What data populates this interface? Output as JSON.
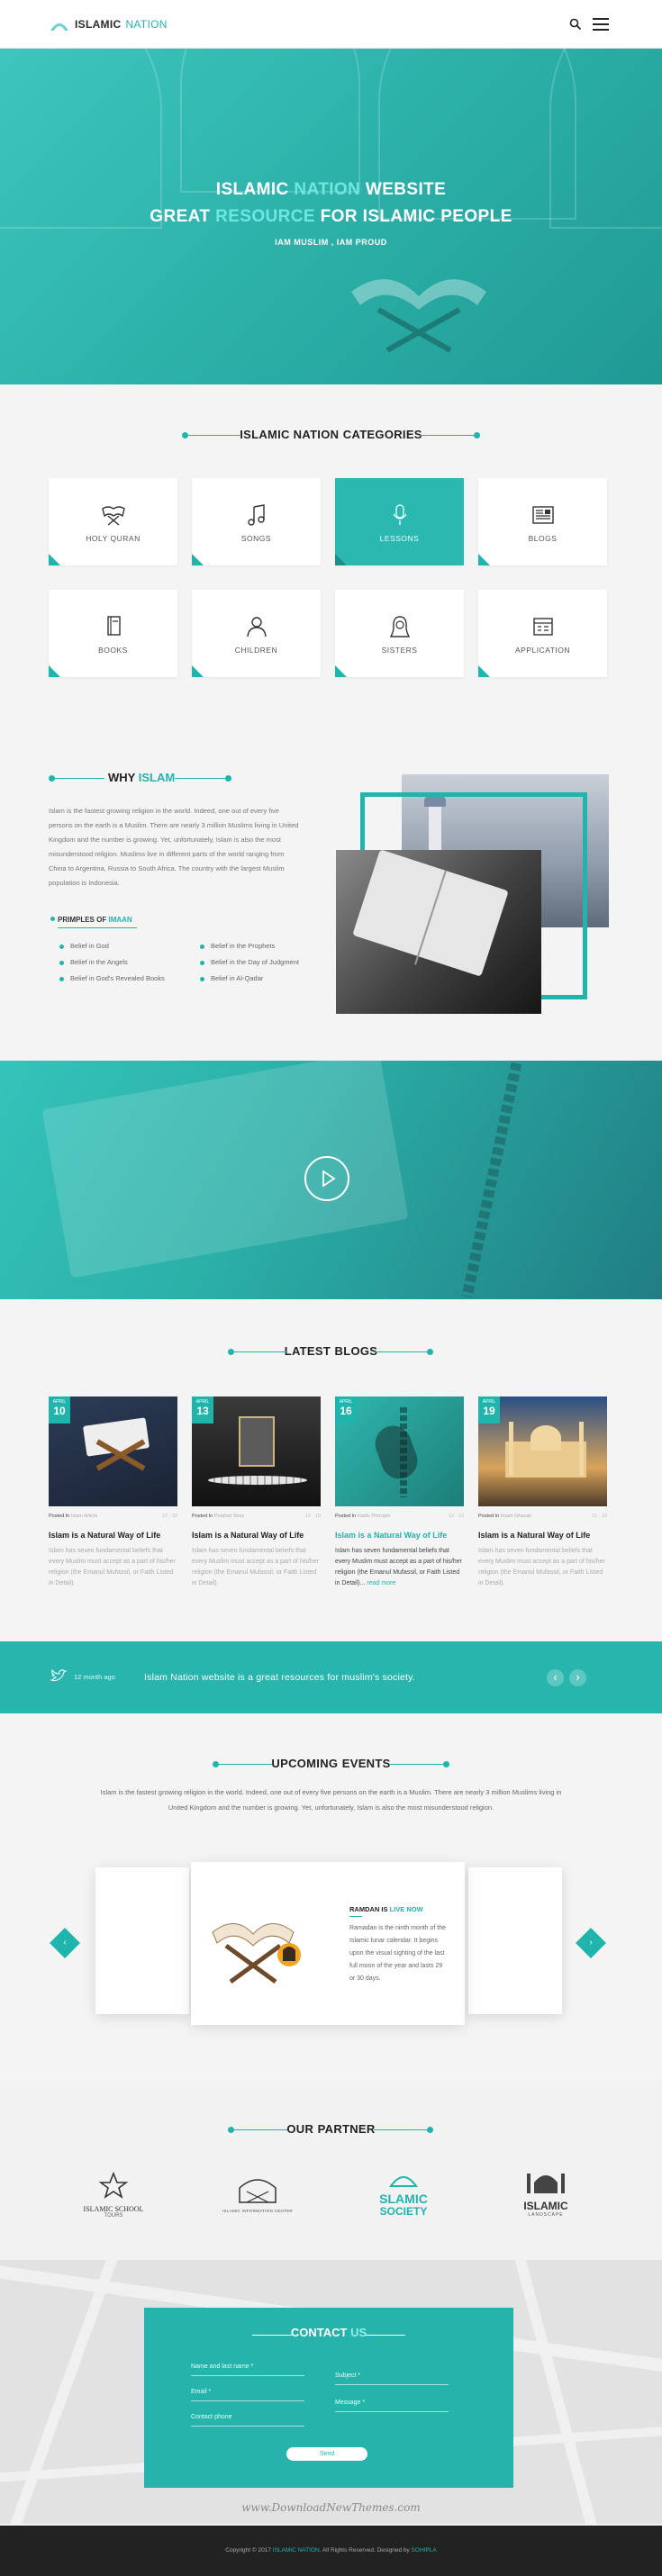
{
  "header": {
    "logo_bold": "ISLAMIC",
    "logo_light": "NATION",
    "search_icon": "search-icon",
    "menu_icon": "hamburger-icon"
  },
  "hero": {
    "line1_a": "ISLAMIC",
    "line1_hl": "NATION",
    "line1_b": "WEBSITE",
    "line2_a": "GREAT",
    "line2_hl": "RESOURCE",
    "line2_b": "FOR ISLAMIC PEOPLE",
    "subtitle": "IAM MUSLIM , IAM PROUD"
  },
  "categories": {
    "title_a": "ISLAMIC NATION",
    "title_b": "CATEGORIES",
    "items": [
      {
        "label": "HOLY QURAN",
        "icon": "quran-icon"
      },
      {
        "label": "SONGS",
        "icon": "music-note-icon"
      },
      {
        "label": "LESSONS",
        "icon": "microphone-icon"
      },
      {
        "label": "BLOGS",
        "icon": "newspaper-icon"
      },
      {
        "label": "BOOKS",
        "icon": "book-icon"
      },
      {
        "label": "CHILDREN",
        "icon": "child-icon"
      },
      {
        "label": "SISTERS",
        "icon": "hijab-icon"
      },
      {
        "label": "APPLICATION",
        "icon": "application-icon"
      }
    ]
  },
  "why": {
    "title_a": "WHY",
    "title_b": "ISLAM",
    "text": "Islam is the fastest growing religion in the world. Indeed, one out of every five persons on the earth is a Muslim. There are nearly 3 million Muslims living in United Kingdom and the number is growing. Yet, unfortunately, Islam is also the most misunderstood religion. Muslims live in different parts of the world ranging from China to Argentina, Russia to South Africa. The country with the largest Muslim population is Indonesia.",
    "principles_a": "PRIMPLES OF",
    "principles_b": "IMAAN",
    "beliefs": [
      "Belief in God",
      "Belief in the Prophets",
      "Belief in the Angels",
      "Belief in the Day of Judgment",
      "Belief in God's Revealed Books",
      "Belief in Al-Qadar"
    ]
  },
  "video": {
    "play_icon": "play-icon"
  },
  "blogs": {
    "title_a": "LATEST",
    "title_b": "BLOGS",
    "items": [
      {
        "month": "APRIL",
        "day": "10",
        "posted": "Posted In",
        "author": "Islam Article",
        "counts": "12  ·  10",
        "title": "Islam is a Natural Way of Life",
        "excerpt": "Islam has seven fundamental beliefs that every Muslim must accept as a part of his/her religion (the Emanul Mufassil, or Faith Listed in Detail)."
      },
      {
        "month": "APRIL",
        "day": "13",
        "posted": "Posted In",
        "author": "Prophet Story",
        "counts": "12  ·  10",
        "title": "Islam is a Natural Way of Life",
        "excerpt": "Islam has seven fundamental beliefs that every Muslim must accept as a part of his/her religion (the Emanul Mufassil, or Faith Listed in Detail)."
      },
      {
        "month": "APRIL",
        "day": "16",
        "posted": "Posted In",
        "author": "Hadis Principle",
        "counts": "12  ·  10",
        "title": "Islam is a Natural Way of Life",
        "excerpt": "Islam has seven fundamental beliefs that every Muslim must accept as a part of his/her religion (the Emanul Mufassil, or Faith Listed in Detail)...",
        "read_more": "read more"
      },
      {
        "month": "APRIL",
        "day": "19",
        "posted": "Posted In",
        "author": "Imam Ghazali",
        "counts": "12  ·  10",
        "title": "Islam is a Natural Way of Life",
        "excerpt": "Islam has seven fundamental beliefs that every Muslim must accept as a part of his/her religion (the Emanul Mufassil, or Faith Listed in Detail)."
      }
    ]
  },
  "tweet": {
    "time": "12 month ago",
    "text": "Islam Nation website is a great resources for muslim's society.",
    "prev": "‹",
    "next": "›"
  },
  "events": {
    "title_a": "UPCOMING",
    "title_b": "EVENTS",
    "description": "Islam is the fastest growing religion in the world. Indeed, one out of every five persons on the earth is a Muslim. There are nearly 3 million Muslims living in United Kingdom and the number is growing. Yet, unfortunately, Islam is also the most misunderstood religion.",
    "card_title_a": "RAMDAN IS",
    "card_title_b": "LIVE NOW",
    "card_text": "Ramadan is the ninth month of the Islamic lunar calendar. It begins upon the visual sighting of the last full moon of the year and lasts 29 or 30 days.",
    "prev": "‹",
    "next": "›"
  },
  "partner": {
    "title_a": "OUR",
    "title_b": "PARTNER",
    "logos": [
      {
        "line1": "ISLAMIC SCHOOL",
        "line2": "TOURS"
      },
      {
        "line1": "ISLAMIC INFORMATION CENTER",
        "line2": ""
      },
      {
        "line1": "SLAMIC",
        "line2": "SOCIETY"
      },
      {
        "line1": "ISLAMIC",
        "line2": "LANDSCAPE"
      }
    ]
  },
  "contact": {
    "title_a": "CONTACT",
    "title_b": "US",
    "name_placeholder": "Name and last name *",
    "subject_placeholder": "Subject *",
    "email_placeholder": "Email *",
    "message_placeholder": "Message *",
    "phone_placeholder": "Contact phone",
    "send_label": "Send"
  },
  "watermark": "www.DownloadNewThemes.com",
  "footer": {
    "a": "Copyright © 2017",
    "b": "ISLAMIC NATION",
    "c": ". All Rights Reserved. Designed by",
    "d": "SOHIPLA"
  },
  "colors": {
    "accent": "#1fb5ad",
    "dark": "#222222"
  }
}
